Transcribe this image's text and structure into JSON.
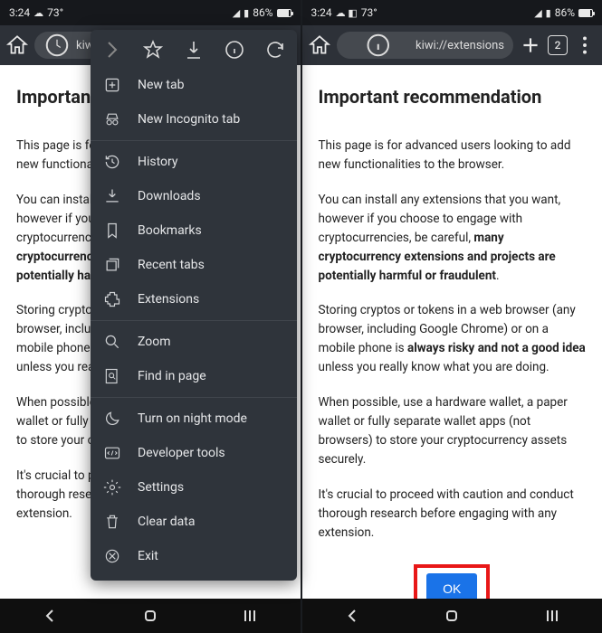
{
  "status": {
    "time": "3:24",
    "temp": "73°",
    "battery": "86%"
  },
  "left": {
    "url": "kiwi:/",
    "heading": "Important",
    "para1": "This page is fo",
    "para1b": "new functionali",
    "para2a": "You can install",
    "para2b": "however if you",
    "para2c": "cryptocurrenci",
    "para2d": "cryptocurrency",
    "para2e": "potentially harm",
    "para3a": "Storing cryptos",
    "para3b": "browser, includ",
    "para3c": "mobile phone i",
    "para3d": "unless you real",
    "para4a": "When possible",
    "para4b": "wallet or fully s",
    "para4c": "to store your cr",
    "para5a": "It's crucial to p",
    "para5b": "thorough resea",
    "para5c": "extension."
  },
  "right": {
    "url": "kiwi://extensions",
    "tab_count": "2",
    "heading": "Important recommendation",
    "p1": "This page is for advanced users looking to add new functionalities to the browser.",
    "p2a": "You can install any extensions that you want, however if you choose to engage with cryptocurrencies, be careful, ",
    "p2b": "many cryptocurrency extensions and projects are potentially harmful or fraudulent",
    "p3a": "Storing cryptos or tokens in a web browser (any browser, including Google Chrome) or on a mobile phone is ",
    "p3b": "always risky and not a good idea",
    "p3c": " unless you really know what you are doing.",
    "p4": "When possible, use a hardware wallet, a paper wallet or fully separate wallet apps (not browsers) to store your cryptocurrency assets securely.",
    "p5": "It's crucial to proceed with caution and conduct thorough research before engaging with any extension.",
    "ok": "OK"
  },
  "menu": {
    "new_tab": "New tab",
    "incognito": "New Incognito tab",
    "history": "History",
    "downloads": "Downloads",
    "bookmarks": "Bookmarks",
    "recent_tabs": "Recent tabs",
    "extensions": "Extensions",
    "zoom": "Zoom",
    "find": "Find in page",
    "night": "Turn on night mode",
    "devtools": "Developer tools",
    "settings": "Settings",
    "clear": "Clear data",
    "exit": "Exit"
  }
}
